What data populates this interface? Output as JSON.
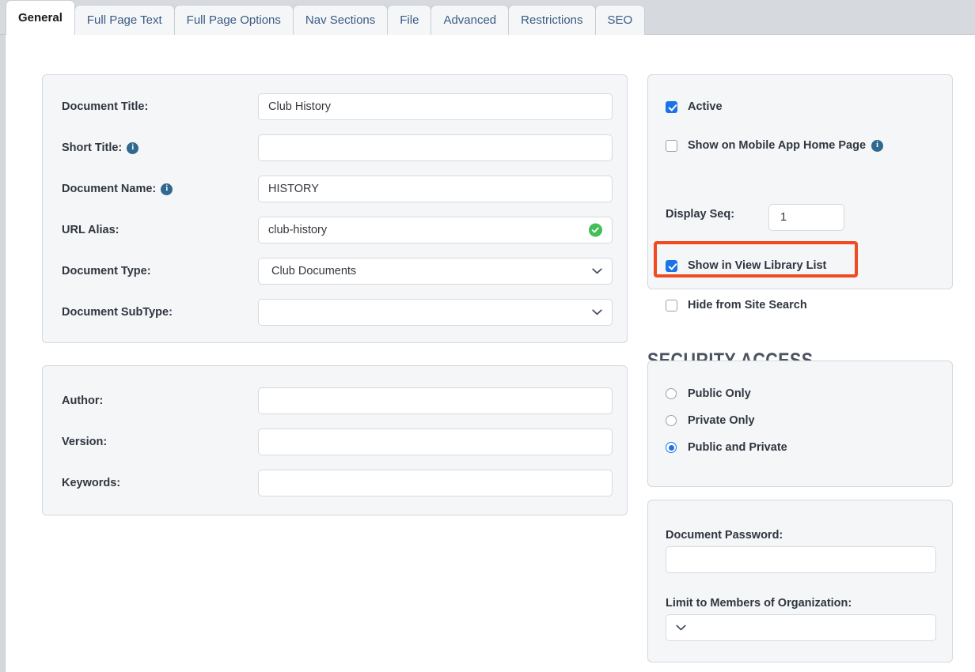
{
  "tabs": [
    {
      "label": "General",
      "active": true
    },
    {
      "label": "Full Page Text",
      "active": false
    },
    {
      "label": "Full Page Options",
      "active": false
    },
    {
      "label": "Nav Sections",
      "active": false
    },
    {
      "label": "File",
      "active": false
    },
    {
      "label": "Advanced",
      "active": false
    },
    {
      "label": "Restrictions",
      "active": false
    },
    {
      "label": "SEO",
      "active": false
    }
  ],
  "document_card": {
    "fields": [
      {
        "label": "Document Title:",
        "value": "Club History",
        "info": false,
        "type": "text"
      },
      {
        "label": "Short Title:",
        "value": "",
        "info": true,
        "type": "text"
      },
      {
        "label": "Document Name:",
        "value": "HISTORY",
        "info": true,
        "type": "text"
      },
      {
        "label": "URL Alias:",
        "value": "club-history",
        "info": false,
        "type": "text",
        "status": "valid"
      },
      {
        "label": "Document Type:",
        "value": "Club Documents",
        "info": false,
        "type": "select"
      },
      {
        "label": "Document SubType:",
        "value": "",
        "info": false,
        "type": "select"
      }
    ]
  },
  "meta_card": {
    "fields": [
      {
        "label": "Author:",
        "value": "",
        "type": "text"
      },
      {
        "label": "Version:",
        "value": "",
        "type": "text"
      },
      {
        "label": "Keywords:",
        "value": "",
        "type": "text"
      }
    ]
  },
  "flags_card": {
    "active": {
      "label": "Active",
      "checked": true
    },
    "mobile": {
      "label": "Show on Mobile App Home Page",
      "checked": false,
      "info": true
    },
    "display_seq": {
      "label": "Display Seq:",
      "value": "1"
    },
    "view_library": {
      "label": "Show in View Library List",
      "checked": true,
      "highlighted": true
    },
    "hide_search": {
      "label": "Hide from Site Search",
      "checked": false
    }
  },
  "security": {
    "heading": "SECURITY ACCESS",
    "options": [
      {
        "label": "Public Only",
        "selected": false
      },
      {
        "label": "Private Only",
        "selected": false
      },
      {
        "label": "Public and Private",
        "selected": true
      }
    ]
  },
  "password_card": {
    "password_label": "Document Password:",
    "password_value": "",
    "org_label": "Limit to Members of Organization:",
    "org_value": ""
  },
  "icons": {
    "info": "i",
    "valid_check": "check-circle-icon",
    "chevron": "chevron-down-icon"
  },
  "colors": {
    "accent_blue": "#1a73e8",
    "tab_text": "#3a5b84",
    "highlight_orange": "#ef4a21",
    "valid_green": "#40c057",
    "info_blue": "#31688e",
    "panel_bg": "#f5f6f8",
    "tabstrip_bg": "#d6d9dd"
  }
}
